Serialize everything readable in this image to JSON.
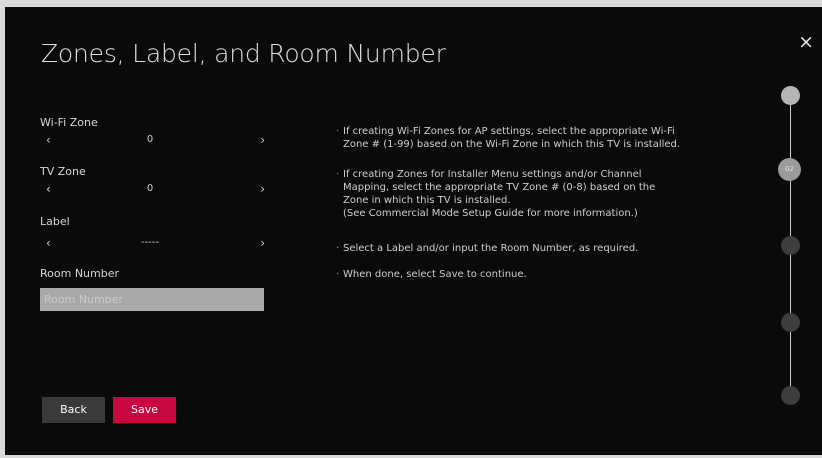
{
  "title": "Zones, Label, and Room Number",
  "close_glyph": "×",
  "fields": {
    "wifi_zone": {
      "label": "Wi-Fi Zone",
      "value": "0",
      "prev": "‹",
      "next": "›"
    },
    "tv_zone": {
      "label": "TV Zone",
      "value": "0",
      "prev": "‹",
      "next": "›"
    },
    "label": {
      "label": "Label",
      "value": "-----",
      "prev": "‹",
      "next": "›"
    },
    "room_number": {
      "label": "Room Number",
      "placeholder": "Room Number"
    }
  },
  "buttons": {
    "back": "Back",
    "save": "Save"
  },
  "help": [
    [
      "If creating Wi-Fi Zones for AP settings, select the appropriate Wi-Fi",
      "Zone # (1-99) based on the Wi-Fi Zone in which this TV is installed."
    ],
    [
      "If creating Zones for Installer Menu settings and/or Channel",
      "Mapping, select the appropriate TV Zone # (0-8) based on the",
      "Zone in which this TV is installed.",
      "(See Commercial Mode Setup Guide for more information.)"
    ],
    [
      "Select a Label and/or input the Room Number, as required."
    ],
    [
      "When done, select Save to continue."
    ]
  ],
  "help_bullet": "·",
  "stepper": {
    "current_label": "02",
    "steps": [
      "done",
      "current",
      "pending",
      "pending",
      "pending"
    ]
  }
}
